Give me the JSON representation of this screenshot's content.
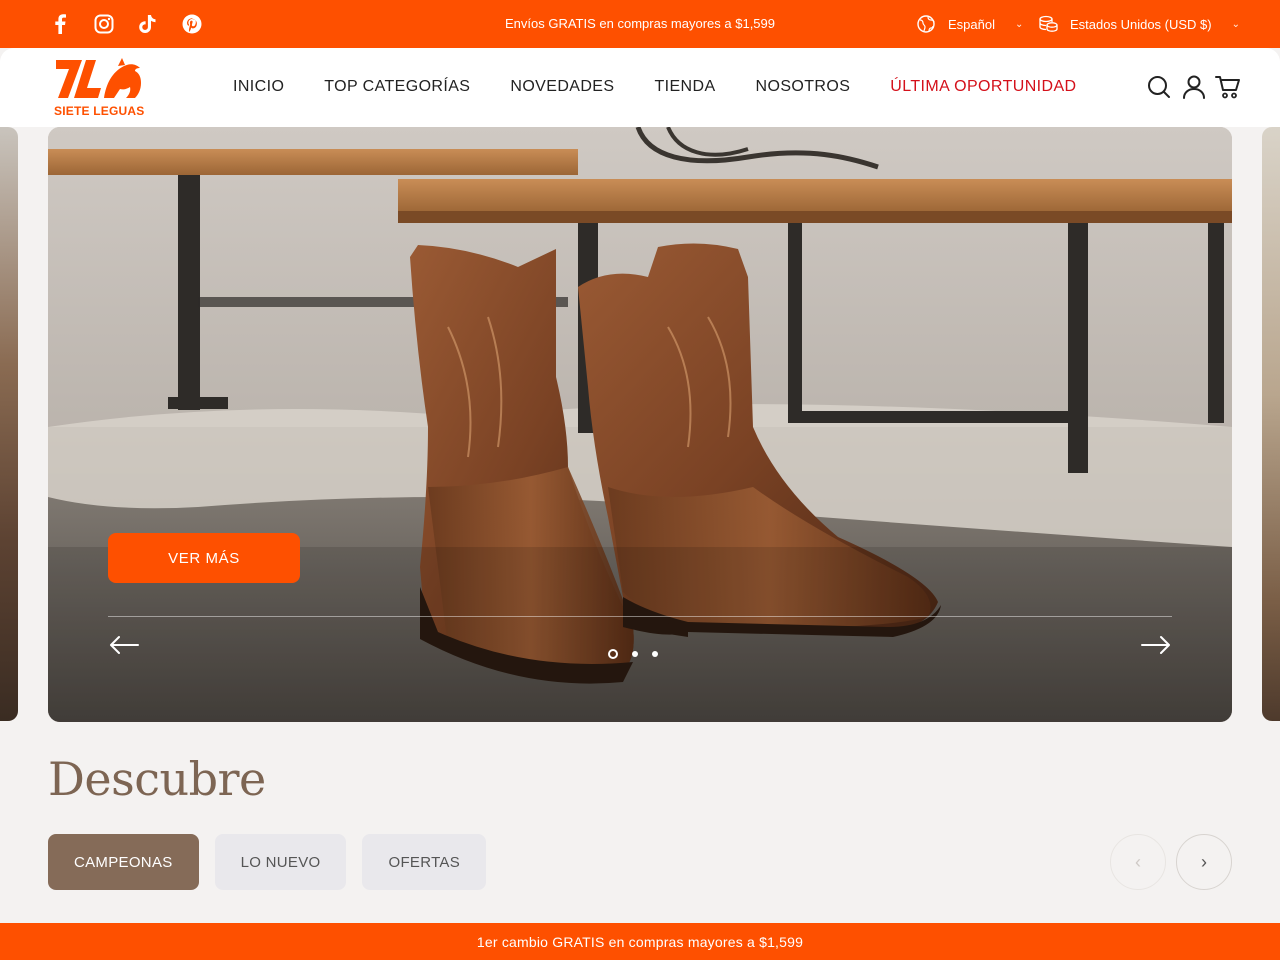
{
  "topbar": {
    "social": [
      {
        "icon": "facebook-icon"
      },
      {
        "icon": "instagram-icon"
      },
      {
        "icon": "tiktok-icon"
      },
      {
        "icon": "pinterest-icon"
      }
    ],
    "announcement": "Envíos GRATIS en compras mayores a $1,599",
    "language": "Español",
    "currency": "Estados Unidos (USD $)"
  },
  "header": {
    "logo_text": "SIETE LEGUAS",
    "nav": [
      "INICIO",
      "TOP CATEGORÍAS",
      "NOVEDADES",
      "TIENDA",
      "NOSOTROS",
      "ÚLTIMA OPORTUNIDAD"
    ],
    "icons": [
      "search-icon",
      "account-icon",
      "cart-icon"
    ]
  },
  "hero": {
    "cta_label": "VER MÁS",
    "slides_total": 3,
    "active_slide": 1
  },
  "discover": {
    "title": "Descubre",
    "tabs": [
      "CAMPEONAS",
      "LO NUEVO",
      "OFERTAS"
    ],
    "active_tab": 0
  },
  "bottom_banner": "1er cambio GRATIS en compras mayores a $1,599",
  "colors": {
    "brand_orange": "#fe5000",
    "sale_red": "#d4101a",
    "title_brown": "#7d6553",
    "active_tab": "#856b58"
  }
}
